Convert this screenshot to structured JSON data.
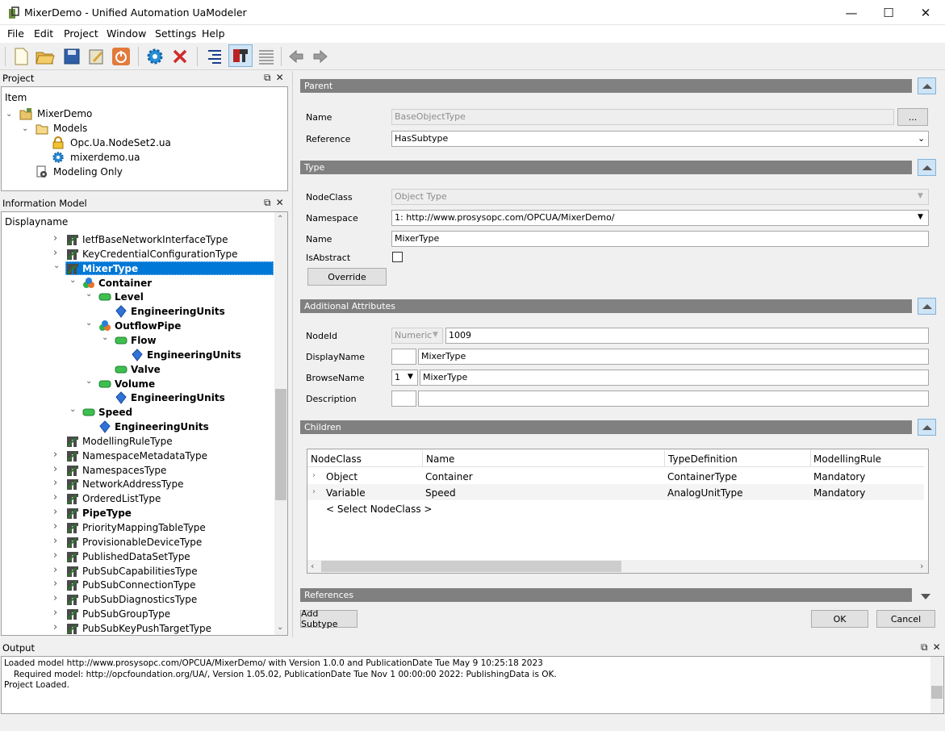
{
  "window": {
    "title": "MixerDemo - Unified Automation UaModeler",
    "minimize": "—",
    "maximize": "☐",
    "close": "✕"
  },
  "menu": [
    "File",
    "Edit",
    "Project",
    "Window",
    "Settings",
    "Help"
  ],
  "project_panel": {
    "title": "Project",
    "header": "Item",
    "items": [
      "MixerDemo",
      "Models",
      "Opc.Ua.NodeSet2.ua",
      "mixerdemo.ua",
      "Modeling Only"
    ]
  },
  "info_panel": {
    "title": "Information Model",
    "header": "Displayname",
    "rows": [
      "IetfBaseNetworkInterfaceType",
      "KeyCredentialConfigurationType",
      "MixerType",
      "Container",
      "Level",
      "EngineeringUnits",
      "OutflowPipe",
      "Flow",
      "EngineeringUnits",
      "Valve",
      "Volume",
      "EngineeringUnits",
      "Speed",
      "EngineeringUnits",
      "ModellingRuleType",
      "NamespaceMetadataType",
      "NamespacesType",
      "NetworkAddressType",
      "OrderedListType",
      "PipeType",
      "PriorityMappingTableType",
      "ProvisionableDeviceType",
      "PublishedDataSetType",
      "PubSubCapabilitiesType",
      "PubSubConnectionType",
      "PubSubDiagnosticsType",
      "PubSubGroupType",
      "PubSubKeyPushTargetType"
    ]
  },
  "editor": {
    "parent": {
      "title": "Parent",
      "name_label": "Name",
      "name_value": "BaseObjectType",
      "browse": "...",
      "reference_label": "Reference",
      "reference_value": "HasSubtype"
    },
    "type": {
      "title": "Type",
      "nodeclass_label": "NodeClass",
      "nodeclass_value": "Object Type",
      "namespace_label": "Namespace",
      "namespace_value": "1: http://www.prosysopc.com/OPCUA/MixerDemo/",
      "name_label": "Name",
      "name_value": "MixerType",
      "isabstract_label": "IsAbstract",
      "override": "Override"
    },
    "attributes": {
      "title": "Additional Attributes",
      "nodeid_label": "NodeId",
      "nodeid_type": "Numeric",
      "nodeid_value": "1009",
      "displayname_label": "DisplayName",
      "displayname_value": "MixerType",
      "browsename_label": "BrowseName",
      "browsename_ns": "1",
      "browsename_value": "MixerType",
      "description_label": "Description"
    },
    "children": {
      "title": "Children",
      "columns": [
        "NodeClass",
        "Name",
        "TypeDefinition",
        "ModellingRule"
      ],
      "rows": [
        {
          "nodeclass": "Object",
          "name": "Container",
          "typedef": "ContainerType",
          "rule": "Mandatory"
        },
        {
          "nodeclass": "Variable",
          "name": "Speed",
          "typedef": "AnalogUnitType",
          "rule": "Mandatory"
        }
      ],
      "select": "< Select NodeClass >"
    },
    "references": {
      "title": "References"
    },
    "buttons": {
      "add_subtype": "Add Subtype",
      "ok": "OK",
      "cancel": "Cancel"
    }
  },
  "output": {
    "title": "Output",
    "lines": [
      "Loaded model http://www.prosysopc.com/OPCUA/MixerDemo/ with Version 1.0.0 and PublicationDate Tue May 9 10:25:18 2023",
      "Required model: http://opcfoundation.org/UA/, Version 1.05.02, PublicationDate Tue Nov 1 00:00:00 2022:  PublishingData is OK.",
      "Project Loaded."
    ]
  }
}
